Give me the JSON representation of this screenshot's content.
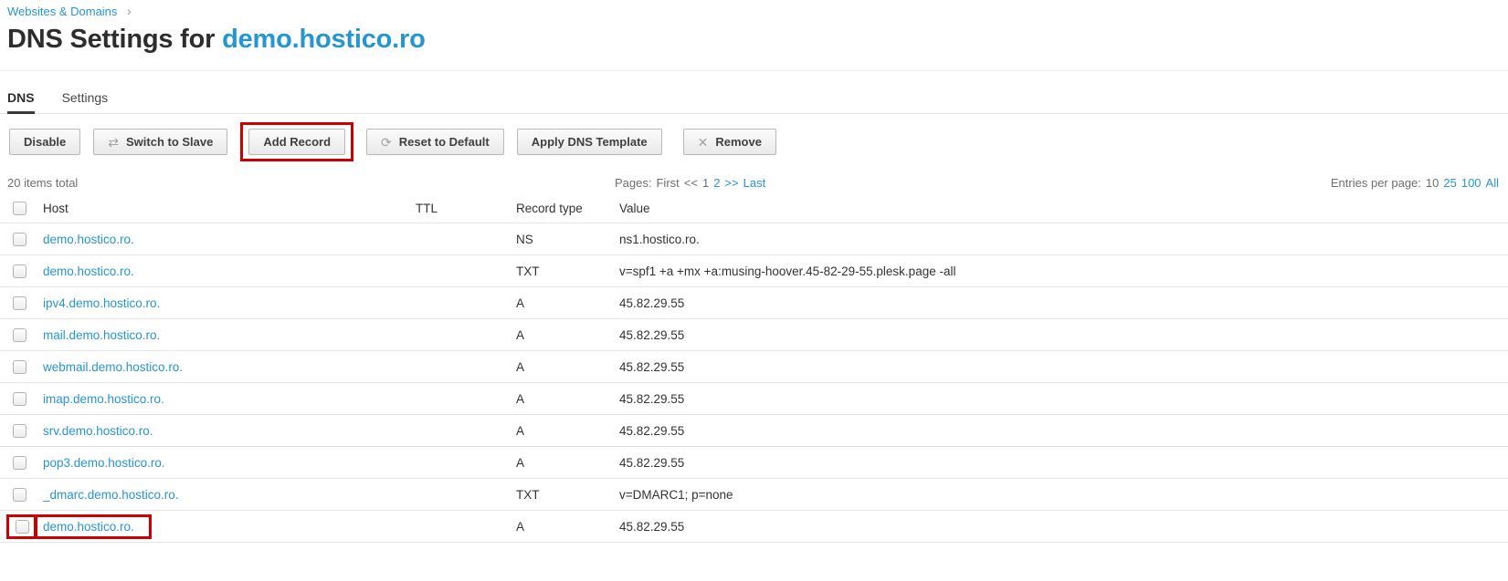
{
  "breadcrumb": {
    "label": "Websites & Domains",
    "separator": "›"
  },
  "title": {
    "prefix": "DNS Settings for",
    "domain": "demo.hostico.ro"
  },
  "tabs": [
    {
      "label": "DNS"
    },
    {
      "label": "Settings"
    }
  ],
  "toolbar": {
    "buttons": [
      {
        "label": "Disable"
      },
      {
        "label": "Switch to Slave",
        "icon": "switch-arrows-icon"
      },
      {
        "label": "Add Record",
        "annotated": true
      },
      {
        "label": "Reset to Default",
        "icon": "reset-refresh-icon"
      },
      {
        "label": "Apply DNS Template"
      },
      {
        "label": "Remove",
        "icon": "remove-x-icon",
        "gap_before": true
      }
    ]
  },
  "list_info": {
    "items_total": "20 items total",
    "pagination": {
      "label": "Pages:",
      "items": [
        {
          "text": "First",
          "name": "first-page",
          "link": false
        },
        {
          "text": "<<",
          "name": "prev-page",
          "link": false
        },
        {
          "text": "1",
          "name": "page-1",
          "link": false
        },
        {
          "text": "2",
          "name": "page-2",
          "link": true
        },
        {
          "text": ">>",
          "name": "next-page",
          "link": true
        },
        {
          "text": "Last",
          "name": "last-page",
          "link": true
        }
      ]
    },
    "entries_per_page": {
      "label": "Entries per page:",
      "items": [
        {
          "text": "10",
          "name": "per-page-10",
          "link": false
        },
        {
          "text": "25",
          "name": "per-page-25",
          "link": true
        },
        {
          "text": "100",
          "name": "per-page-100",
          "link": true
        },
        {
          "text": "All",
          "name": "per-page-all",
          "link": true
        }
      ]
    }
  },
  "table": {
    "columns": {
      "host": "Host",
      "ttl": "TTL",
      "type": "Record type",
      "value": "Value"
    },
    "rows": [
      {
        "host": "demo.hostico.ro.",
        "ttl": "",
        "type": "NS",
        "value": "ns1.hostico.ro."
      },
      {
        "host": "demo.hostico.ro.",
        "ttl": "",
        "type": "TXT",
        "value": "v=spf1 +a +mx +a:musing-hoover.45-82-29-55.plesk.page -all"
      },
      {
        "host": "ipv4.demo.hostico.ro.",
        "ttl": "",
        "type": "A",
        "value": "45.82.29.55"
      },
      {
        "host": "mail.demo.hostico.ro.",
        "ttl": "",
        "type": "A",
        "value": "45.82.29.55"
      },
      {
        "host": "webmail.demo.hostico.ro.",
        "ttl": "",
        "type": "A",
        "value": "45.82.29.55"
      },
      {
        "host": "imap.demo.hostico.ro.",
        "ttl": "",
        "type": "A",
        "value": "45.82.29.55"
      },
      {
        "host": "srv.demo.hostico.ro.",
        "ttl": "",
        "type": "A",
        "value": "45.82.29.55"
      },
      {
        "host": "pop3.demo.hostico.ro.",
        "ttl": "",
        "type": "A",
        "value": "45.82.29.55"
      },
      {
        "host": "_dmarc.demo.hostico.ro.",
        "ttl": "",
        "type": "TXT",
        "value": "v=DMARC1; p=none"
      },
      {
        "host": "demo.hostico.ro.",
        "ttl": "",
        "type": "A",
        "value": "45.82.29.55",
        "annotated": true
      }
    ]
  },
  "colors": {
    "link": "#2596d1",
    "annotation": "#cc0000"
  }
}
